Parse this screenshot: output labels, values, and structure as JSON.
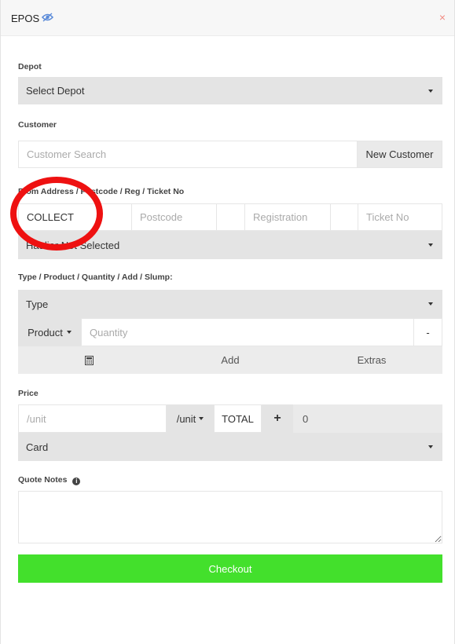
{
  "header": {
    "title": "EPOS",
    "close_glyph": "×",
    "eye_icon": "eye-icon",
    "close_icon": "close-icon"
  },
  "depot": {
    "label": "Depot",
    "selected": "Select Depot"
  },
  "customer": {
    "label": "Customer",
    "search_placeholder": "Customer Search",
    "new_button": "New Customer"
  },
  "address": {
    "label": "From Address / Postcode / Reg / Ticket No",
    "address_value": "COLLECT",
    "postcode_placeholder": "Postcode",
    "registration_placeholder": "Registration",
    "ticket_placeholder": "Ticket No",
    "haulier_selected": "Haulier Not Selected"
  },
  "product": {
    "label": "Type / Product / Quantity / Add / Slump:",
    "type_selected": "Type",
    "product_button": "Product",
    "quantity_placeholder": "Quantity",
    "minus": "-",
    "calculator_icon": "calculator-icon",
    "add_label": "Add",
    "extras_label": "Extras"
  },
  "price": {
    "label": "Price",
    "unit_placeholder": "/unit",
    "unit_dropdown": "/unit",
    "total_label": "TOTAL",
    "plus": "+",
    "total_value": "0",
    "payment_selected": "Card"
  },
  "notes": {
    "label": "Quote Notes",
    "info_icon": "info-icon"
  },
  "checkout": {
    "label": "Checkout"
  },
  "colors": {
    "checkout": "#43e02c",
    "annotation": "#ee1111",
    "close": "#f28b82",
    "eye": "#5b8bd9"
  }
}
